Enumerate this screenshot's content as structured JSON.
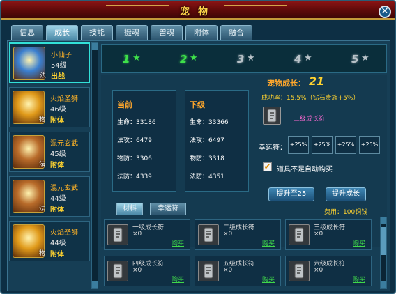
{
  "window": {
    "title": "宠物",
    "close_symbol": "✕"
  },
  "tabs": [
    {
      "label": "信息",
      "active": false
    },
    {
      "label": "成长",
      "active": true
    },
    {
      "label": "技能",
      "active": false
    },
    {
      "label": "摄魂",
      "active": false
    },
    {
      "label": "兽魂",
      "active": false
    },
    {
      "label": "附体",
      "active": false
    },
    {
      "label": "融合",
      "active": false
    }
  ],
  "pets": [
    {
      "name": "小仙子",
      "level": "54级",
      "status": "出战",
      "type": "法",
      "selected": true,
      "portrait_color": "#3a7fd0"
    },
    {
      "name": "火焰圣狮",
      "level": "46级",
      "status": "附体",
      "type": "物",
      "selected": false,
      "portrait_color": "#e09a1a"
    },
    {
      "name": "混元玄武",
      "level": "45级",
      "status": "附体",
      "type": "法",
      "selected": false,
      "portrait_color": "#b86b2a"
    },
    {
      "name": "混元玄武",
      "level": "44级",
      "status": "附体",
      "type": "法",
      "selected": false,
      "portrait_color": "#b86b2a"
    },
    {
      "name": "火焰圣狮",
      "level": "44级",
      "status": "附体",
      "type": "物",
      "selected": false,
      "portrait_color": "#e09a1a"
    }
  ],
  "stages": [
    {
      "num": "1",
      "star": "★",
      "achieved": true
    },
    {
      "num": "2",
      "star": "★",
      "achieved": true
    },
    {
      "num": "3",
      "star": "★",
      "achieved": false
    },
    {
      "num": "4",
      "star": "★",
      "achieved": false
    },
    {
      "num": "5",
      "star": "★",
      "achieved": false
    }
  ],
  "current": {
    "header": "当前",
    "hp": "生命：33186",
    "matk": "法攻：6479",
    "pdef": "物防：3306",
    "mdef": "法防：4339"
  },
  "next": {
    "header": "下级",
    "hp": "生命：33366",
    "matk": "法攻：6497",
    "pdef": "物防：3318",
    "mdef": "法防：4351"
  },
  "growth": {
    "label": "宠物成长：",
    "value": "21",
    "success_rate": "成功率：15.5%（钻石贵族+5%）",
    "item_name": "三级成长符"
  },
  "lucky": {
    "label": "幸运符：",
    "slots": [
      "+25%",
      "+25%",
      "+25%",
      "+25%"
    ]
  },
  "auto_buy": {
    "checked": true,
    "label": "道具不足自动购买",
    "check_symbol": "✔"
  },
  "buttons": {
    "upgrade_to": "提升至25",
    "upgrade": "提升成长"
  },
  "subtabs": [
    {
      "label": "材料",
      "active": true
    },
    {
      "label": "幸运符",
      "active": false
    }
  ],
  "cost": "费用：100铜钱",
  "items": [
    {
      "name": "一级成长符",
      "qty": "×0",
      "buy": "购买"
    },
    {
      "name": "二级成长符",
      "qty": "×0",
      "buy": "购买"
    },
    {
      "name": "三级成长符",
      "qty": "×0",
      "buy": "购买"
    },
    {
      "name": "四级成长符",
      "qty": "×0",
      "buy": "购买"
    },
    {
      "name": "五级成长符",
      "qty": "×0",
      "buy": "购买"
    },
    {
      "name": "六级成长符",
      "qty": "×0",
      "buy": "购买"
    }
  ],
  "colors": {
    "achieved_stage": "#3ee04a",
    "locked_stage": "#b8c2c8"
  }
}
